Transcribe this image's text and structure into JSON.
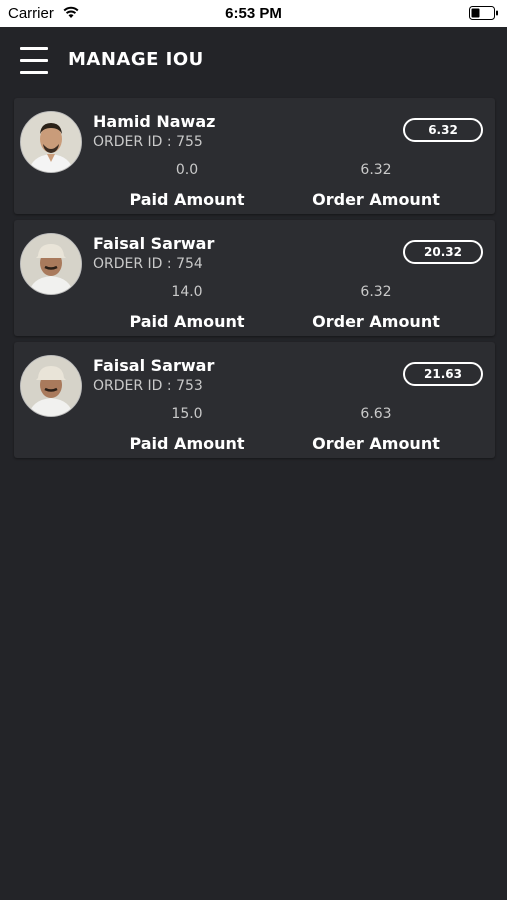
{
  "status_bar": {
    "carrier": "Carrier",
    "time": "6:53 PM"
  },
  "header": {
    "title": "MANAGE IOU"
  },
  "iou_list": [
    {
      "name": "Hamid Nawaz",
      "order_id": "ORDER ID : 755",
      "badge": "6.32",
      "paid_value": "0.0",
      "order_value": "6.32",
      "paid_label": "Paid Amount",
      "order_label": "Order Amount"
    },
    {
      "name": "Faisal Sarwar",
      "order_id": "ORDER ID : 754",
      "badge": "20.32",
      "paid_value": "14.0",
      "order_value": "6.32",
      "paid_label": "Paid Amount",
      "order_label": "Order Amount"
    },
    {
      "name": "Faisal Sarwar",
      "order_id": "ORDER ID : 753",
      "badge": "21.63",
      "paid_value": "15.0",
      "order_value": "6.63",
      "paid_label": "Paid Amount",
      "order_label": "Order Amount"
    }
  ],
  "colors": {
    "background": "#232428",
    "card": "#2c2d31",
    "text": "#ffffff",
    "muted": "#c9c9c9"
  },
  "icons": {
    "menu": "hamburger-icon",
    "wifi": "wifi-icon",
    "battery": "battery-icon"
  }
}
